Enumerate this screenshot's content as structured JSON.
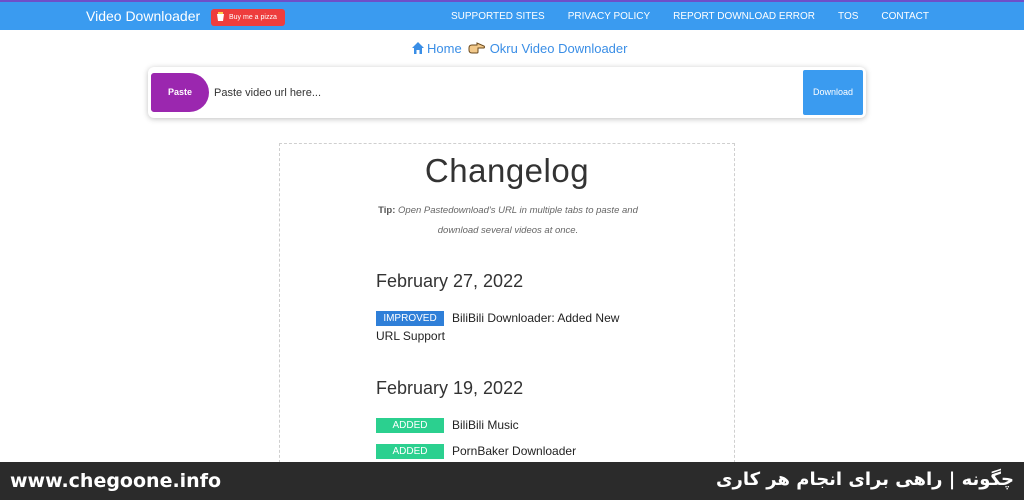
{
  "navbar": {
    "brand": "Video Downloader",
    "pizza_button": "Buy me a pizza",
    "links": [
      "SUPPORTED SITES",
      "PRIVACY POLICY",
      "REPORT DOWNLOAD ERROR",
      "TOS",
      "CONTACT"
    ]
  },
  "breadcrumb": {
    "home": "Home",
    "current": "Okru Video Downloader"
  },
  "search": {
    "paste_label": "Paste",
    "placeholder": "Paste video url here...",
    "download_label": "Download"
  },
  "changelog": {
    "title": "Changelog",
    "tip_label": "Tip:",
    "tip_text": "Open Pastedownload's URL in multiple tabs to paste and download several videos at once.",
    "sections": [
      {
        "date": "February 27, 2022",
        "entries": [
          {
            "badge": "IMPROVED",
            "text": "BiliBili Downloader: Added New URL Support"
          }
        ]
      },
      {
        "date": "February 19, 2022",
        "entries": [
          {
            "badge": "ADDED",
            "text": "BiliBili Music"
          },
          {
            "badge": "ADDED",
            "text": "PornBaker Downloader"
          }
        ]
      }
    ]
  },
  "footer": {
    "left": "www.chegoone.info",
    "right": "چگونه | راهی برای انجام هر کاری"
  },
  "colors": {
    "navbar": "#3a9bf0",
    "paste": "#9b27af",
    "download": "#3a9bf0",
    "improved": "#2f7fd8",
    "added": "#2bd08f"
  }
}
